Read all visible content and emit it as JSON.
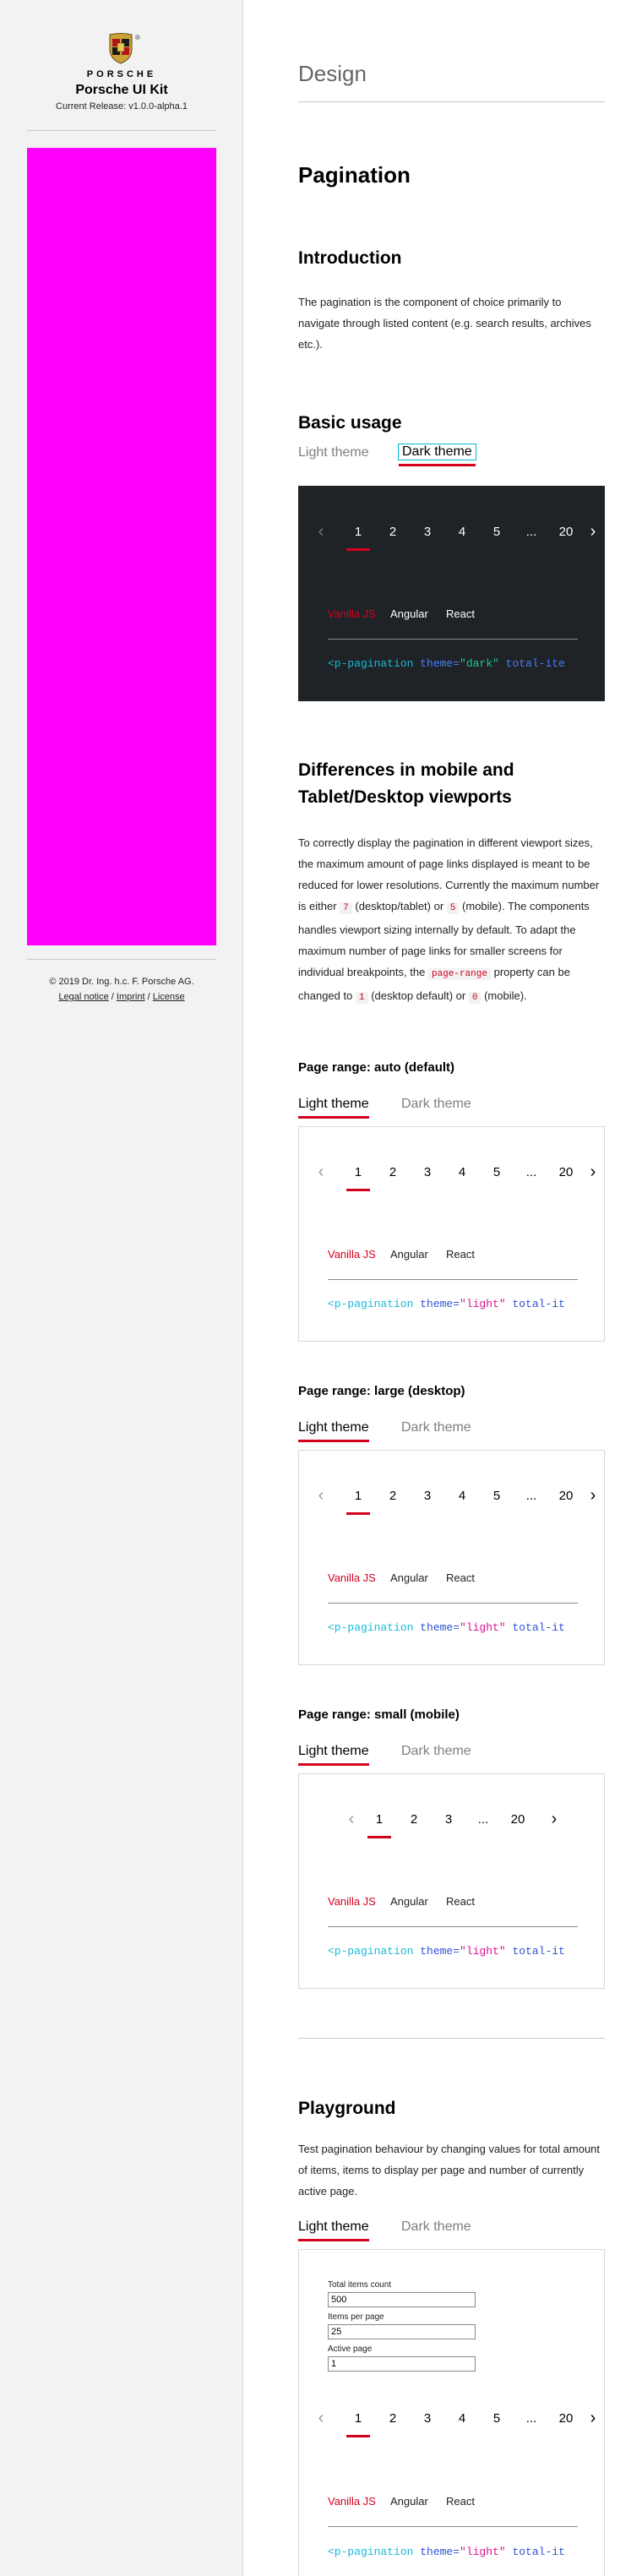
{
  "sidebar": {
    "brand_wordmark": "PORSCHE",
    "registered_mark": "®",
    "kit_title": "Porsche UI Kit",
    "release": "Current Release: v1.0.0-alpha.1",
    "copyright": "© 2019 Dr. Ing. h.c. F. Porsche AG.",
    "links": [
      "Legal notice",
      "Imprint",
      "License"
    ],
    "link_separator": "/",
    "placeholder_color": "#ff00ff"
  },
  "main": {
    "section": "Design",
    "page_title": "Pagination",
    "intro": {
      "heading": "Introduction",
      "text": "The pagination is the component of choice primarily to navigate through listed content (e.g. search results, archives etc.)."
    },
    "basic": {
      "heading": "Basic usage",
      "tabs": [
        "Light theme",
        "Dark theme"
      ]
    },
    "differences": {
      "heading": "Differences in mobile and Tablet/Desktop viewports",
      "p1": "To correctly display the pagination in different viewport sizes, the maximum amount of page links displayed is meant to be reduced for lower resolutions. Currently the maximum number is either",
      "code7": "7",
      "p2": "(desktop/tablet) or",
      "code5": "5",
      "p3": "(mobile). The components handles viewport sizing internally by default. To adapt the maximum number of page links for smaller screens for individual breakpoints, the",
      "code_prop": "page-range",
      "p4": "property can be changed to",
      "code1": "1",
      "p5": "(desktop default) or",
      "code0": "0",
      "p6": "(mobile)."
    },
    "range_auto": {
      "heading": "Page range: auto (default)"
    },
    "range_large": {
      "heading": "Page range: large (desktop)"
    },
    "range_small": {
      "heading": "Page range: small (mobile)"
    },
    "playground": {
      "heading": "Playground",
      "text": "Test pagination behaviour by changing values for total amount of items, items to display per page and number of currently active page.",
      "fields": [
        {
          "label": "Total items count",
          "value": "500"
        },
        {
          "label": "Items per page",
          "value": "25"
        },
        {
          "label": "Active page",
          "value": "1"
        }
      ]
    },
    "theme_tabs": [
      "Light theme",
      "Dark theme"
    ],
    "pagination": {
      "prev": "‹",
      "next": "›",
      "ellipsis": "...",
      "pages_full": [
        "1",
        "2",
        "3",
        "4",
        "5",
        "...",
        "20"
      ],
      "pages_small": [
        "1",
        "2",
        "3",
        "...",
        "20"
      ],
      "active": "1"
    },
    "code_tabs": [
      "Vanilla JS",
      "Angular",
      "React"
    ],
    "code": {
      "dark": {
        "tag": "<p-pagination",
        "attr": " theme=",
        "val": "\"dark\"",
        "rest": " total-ite"
      },
      "light": {
        "tag": "<p-pagination",
        "attr": " theme=",
        "val": "\"light\"",
        "rest": " total-it"
      }
    }
  },
  "colors": {
    "accent": "#d5001c",
    "dark_bg": "#1f2226",
    "focus": "#00bcd4"
  }
}
